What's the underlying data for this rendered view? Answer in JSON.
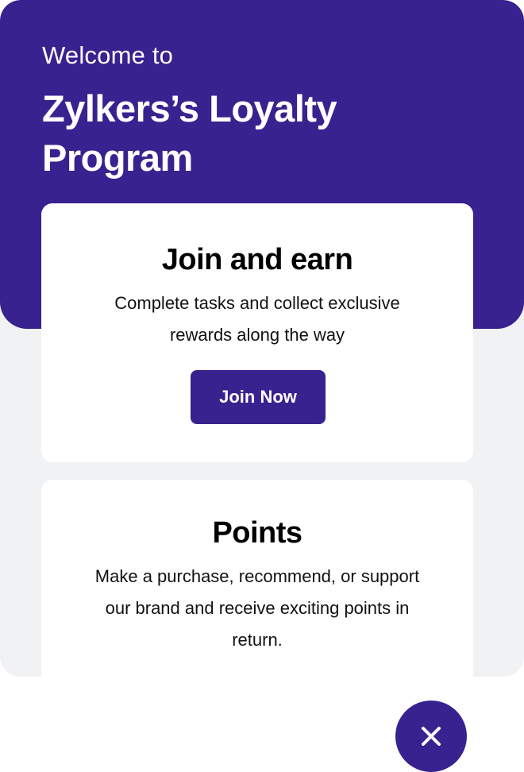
{
  "hero": {
    "welcome": "Welcome to",
    "title": "Zylkers’s Loyalty Program"
  },
  "cards": [
    {
      "title": "Join and earn",
      "description": "Complete tasks and collect exclusive rewards along the way",
      "button_label": "Join Now"
    },
    {
      "title": "Points",
      "description": "Make a purchase, recommend, or support our brand and receive exciting points in return."
    }
  ],
  "close_button": {
    "icon": "close-icon"
  },
  "colors": {
    "brand": "#38228f",
    "background": "#f1f2f4",
    "card": "#ffffff"
  }
}
